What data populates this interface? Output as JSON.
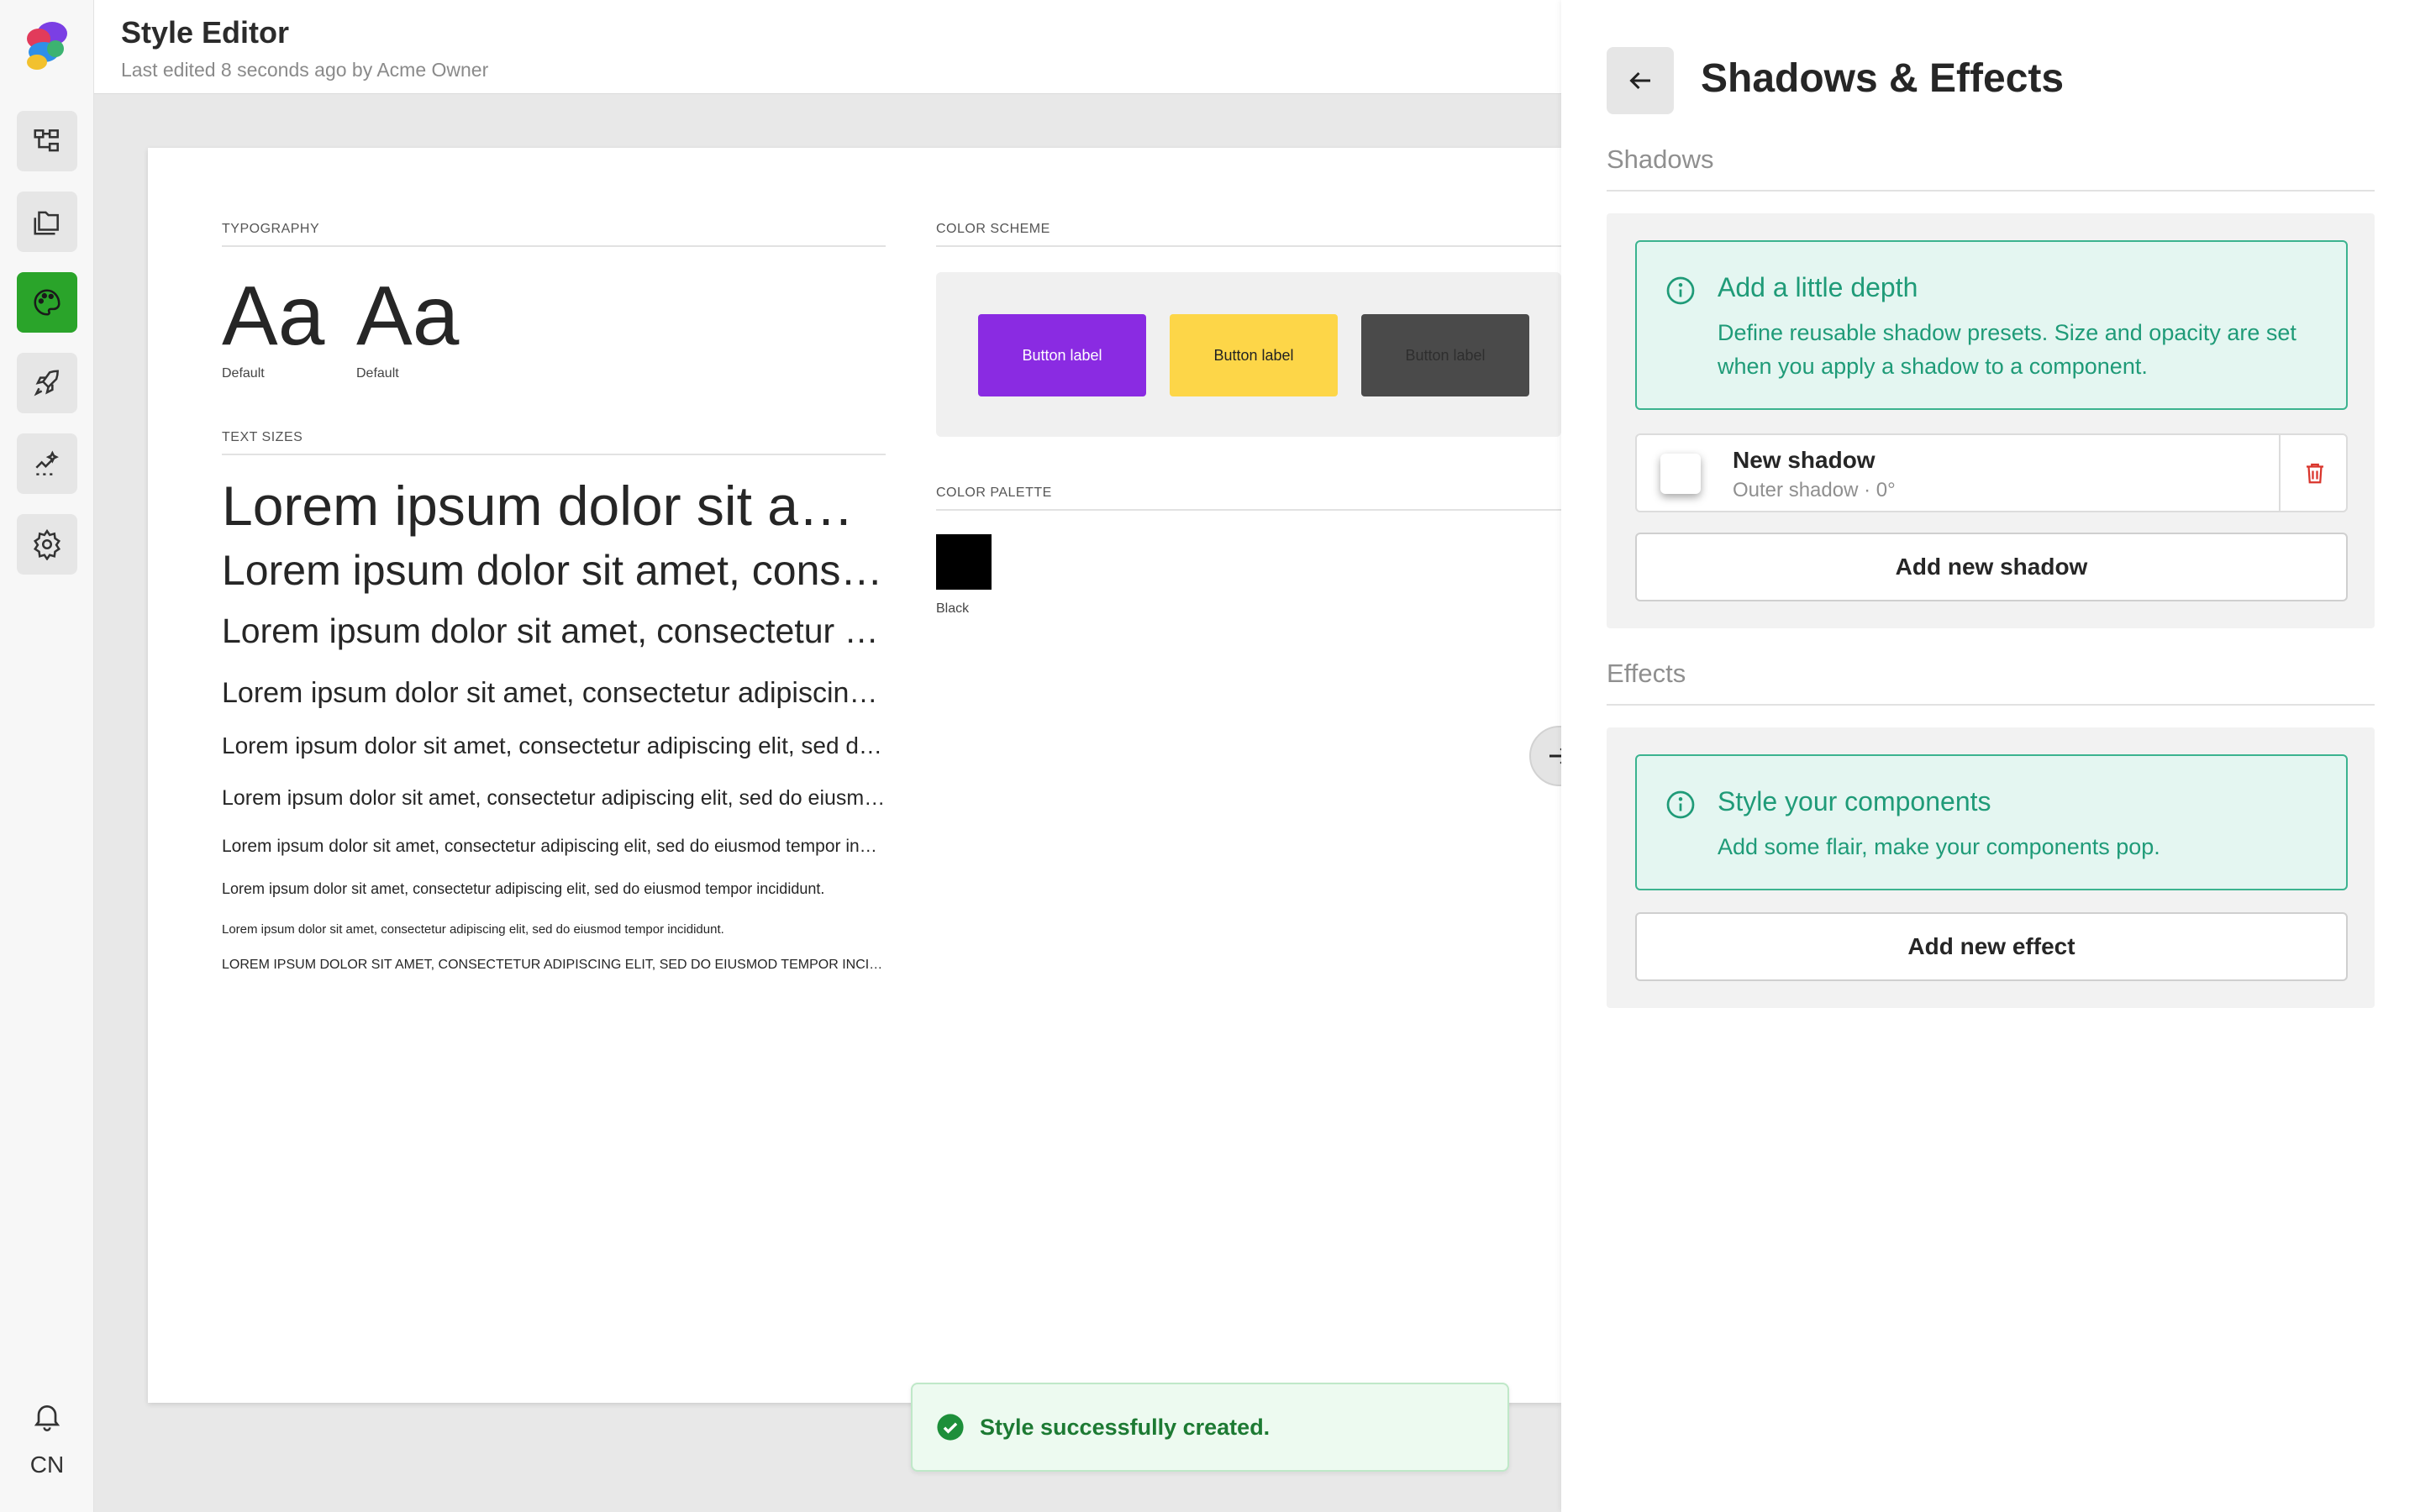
{
  "rail": {
    "items": [
      {
        "icon": "hierarchy-icon"
      },
      {
        "icon": "folders-icon"
      },
      {
        "icon": "palette-icon",
        "active": true
      },
      {
        "icon": "rocket-icon"
      },
      {
        "icon": "analytics-icon"
      },
      {
        "icon": "settings-icon"
      }
    ],
    "user_initials": "CN"
  },
  "header": {
    "title": "Style Editor",
    "subtitle": "Last edited 8 seconds ago by Acme Owner"
  },
  "canvas": {
    "typography": {
      "label": "TYPOGRAPHY",
      "samples": [
        {
          "glyph": "Aa",
          "caption": "Default"
        },
        {
          "glyph": "Aa",
          "caption": "Default"
        }
      ]
    },
    "text_sizes": {
      "label": "TEXT SIZES",
      "lines": [
        "Lorem ipsum dolor sit amet, consectetur adipiscing elit",
        "Lorem ipsum dolor sit amet, consectetur adipiscing elit",
        "Lorem ipsum dolor sit amet, consectetur adipiscing elit",
        "Lorem ipsum dolor sit amet, consectetur adipiscing elit, sed do eiusmod",
        "Lorem ipsum dolor sit amet, consectetur adipiscing elit, sed do eiusmod tempor",
        "Lorem ipsum dolor sit amet, consectetur adipiscing elit, sed do eiusmod tempor incididunt",
        "Lorem ipsum dolor sit amet, consectetur adipiscing elit, sed do eiusmod tempor incididunt.",
        "Lorem ipsum dolor sit amet, consectetur adipiscing elit, sed do eiusmod tempor incididunt.",
        "Lorem ipsum dolor sit amet, consectetur adipiscing elit, sed do eiusmod tempor incididunt.",
        "LOREM IPSUM DOLOR SIT AMET, CONSECTETUR ADIPISCING ELIT, SED DO EIUSMOD TEMPOR INCIDIDUNT."
      ]
    },
    "color_scheme": {
      "label": "COLOR SCHEME",
      "buttons": [
        {
          "label": "Button label",
          "bg": "#8a2be2",
          "fg": "#ffffff"
        },
        {
          "label": "Button label",
          "bg": "#fdd648",
          "fg": "#222222"
        },
        {
          "label": "Button label",
          "bg": "#4a4a4a",
          "fg": "#2e2e2e"
        }
      ]
    },
    "color_palette": {
      "label": "COLOR PALETTE",
      "swatches": [
        {
          "name": "Black",
          "color": "#000000"
        }
      ]
    }
  },
  "toast": {
    "message": "Style successfully created."
  },
  "panel": {
    "title": "Shadows & Effects",
    "shadows": {
      "heading": "Shadows",
      "info_title": "Add a little depth",
      "info_body": "Define reusable shadow presets. Size and opacity are set when you apply a shadow to a component.",
      "item": {
        "name": "New shadow",
        "meta": "Outer shadow · 0°"
      },
      "add_label": "Add new shadow"
    },
    "effects": {
      "heading": "Effects",
      "info_title": "Style your components",
      "info_body": "Add some flair, make your components pop.",
      "add_label": "Add new effect"
    }
  },
  "colors": {
    "accent_green": "#2aa42a",
    "info_teal": "#1f9b78",
    "danger_red": "#d9342b"
  }
}
